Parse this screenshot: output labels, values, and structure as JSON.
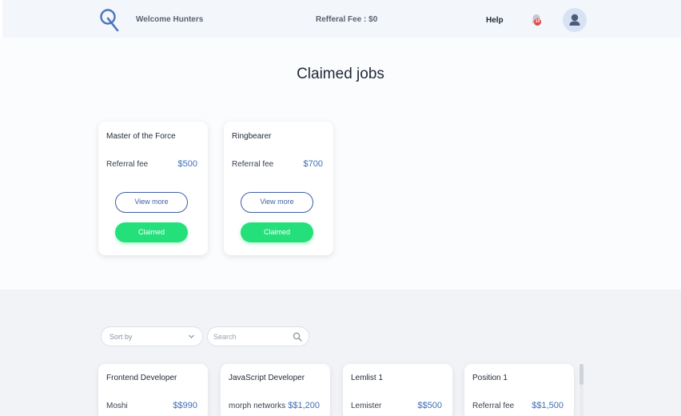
{
  "header": {
    "welcome": "Welcome Hunters",
    "referral_fee": "Refferal Fee : $0",
    "help": "Help",
    "notification_count": "10",
    "logo_icon": "logo-q-icon",
    "bell_icon": "bell-icon",
    "avatar_icon": "user-avatar-icon"
  },
  "claimed": {
    "title": "Claimed jobs",
    "cards": [
      {
        "title": "Master of the Force",
        "fee_label": "Referral fee",
        "fee_value": "$500",
        "view_more": "View more",
        "status": "Claimed"
      },
      {
        "title": "Ringbearer",
        "fee_label": "Referral fee",
        "fee_value": "$700",
        "view_more": "View more",
        "status": "Claimed"
      }
    ]
  },
  "filters": {
    "sort_label": "Sort by",
    "search_placeholder": "Search"
  },
  "jobs": [
    {
      "title": "Frontend Developer",
      "company": "Moshi",
      "fee_value": "$$990"
    },
    {
      "title": "JavaScript Developer",
      "company": "morph networks",
      "fee_value": "$$1,200"
    },
    {
      "title": "Lemlist 1",
      "company": "Lemister",
      "fee_value": "$$500"
    },
    {
      "title": "Position 1",
      "company": "Referral fee",
      "fee_value": "$$1,500"
    }
  ],
  "colors": {
    "accent": "#3f6fb6",
    "claimed_green": "#24e07a",
    "badge_red": "#e5484d"
  }
}
